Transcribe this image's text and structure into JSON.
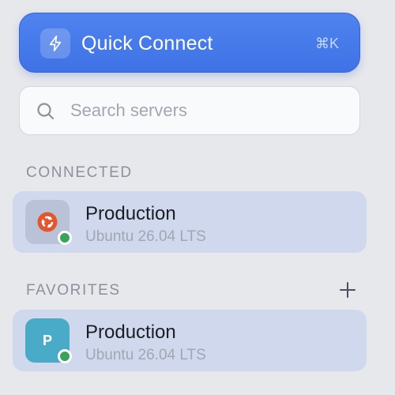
{
  "quick_connect": {
    "label": "Quick Connect",
    "shortcut": "⌘K",
    "icon": "lightning-bolt-icon"
  },
  "search": {
    "placeholder": "Search servers",
    "value": ""
  },
  "sections": {
    "connected": {
      "title": "CONNECTED",
      "servers": [
        {
          "name": "Production",
          "os": "Ubuntu 26.04 LTS",
          "icon": "ubuntu-logo-icon",
          "status": "online"
        }
      ]
    },
    "favorites": {
      "title": "FAVORITES",
      "add_icon": "plus-icon",
      "servers": [
        {
          "name": "Production",
          "os": "Ubuntu 26.04 LTS",
          "icon_letter": "P",
          "status": "online"
        }
      ]
    }
  },
  "colors": {
    "accent": "#3f72e6",
    "row_background": "#d0d8ed",
    "status_online": "#3aa35b",
    "ubuntu_orange": "#e4572e",
    "letter_tile": "#4aabc8"
  }
}
